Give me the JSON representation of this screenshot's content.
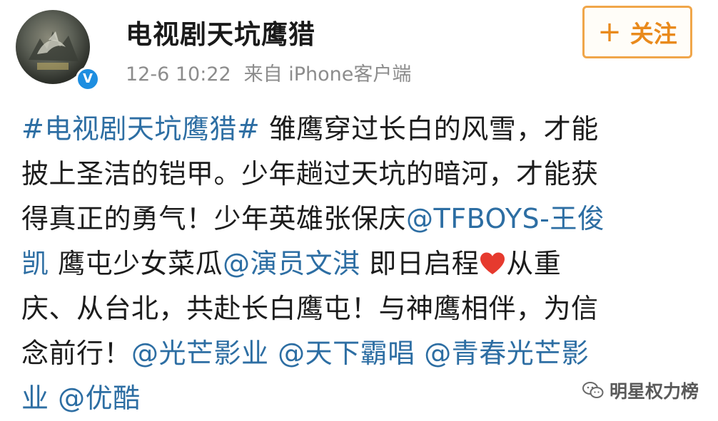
{
  "header": {
    "username": "电视剧天坑鹰猎",
    "time": "12-6 10:22",
    "source": "来自 iPhone客户端",
    "verified_mark": "V"
  },
  "follow_button": {
    "plus": "+",
    "label": "关注",
    "accent_color": "#e98a1c"
  },
  "post": {
    "link_color": "#2d6ea3",
    "lines": [
      {
        "l1_hashtag": "#电视剧天坑鹰猎#",
        "l1_text": " 雏鹰穿过长白的风雪，才能"
      },
      {
        "l2_text": "披上圣洁的铠甲。少年趟过天坑的暗河，才能获"
      },
      {
        "l3_text": "得真正的勇气！少年英雄张保庆",
        "l3_mention": "@TFBOYS-王俊"
      },
      {
        "l4_mention_cont": "凯",
        "l4_text": " 鹰屯少女菜瓜",
        "l4_mention": "@演员文淇",
        "l4_text2": " 即日启程",
        "l4_text3": "从重"
      },
      {
        "l5_text": "庆、从台北，共赴长白鹰屯！与神鹰相伴，为信"
      },
      {
        "l6_text": "念前行！",
        "l6_mention1": "@光芒影业",
        "l6_mention2": "@天下霸唱",
        "l6_mention3": "@青春光芒影"
      },
      {
        "l7_mention_cont": "业",
        "l7_mention": "@优酷"
      }
    ],
    "emoji_icon": "red-heart-icon"
  },
  "watermark": {
    "text": "明星权力榜",
    "icon": "wechat-icon"
  }
}
